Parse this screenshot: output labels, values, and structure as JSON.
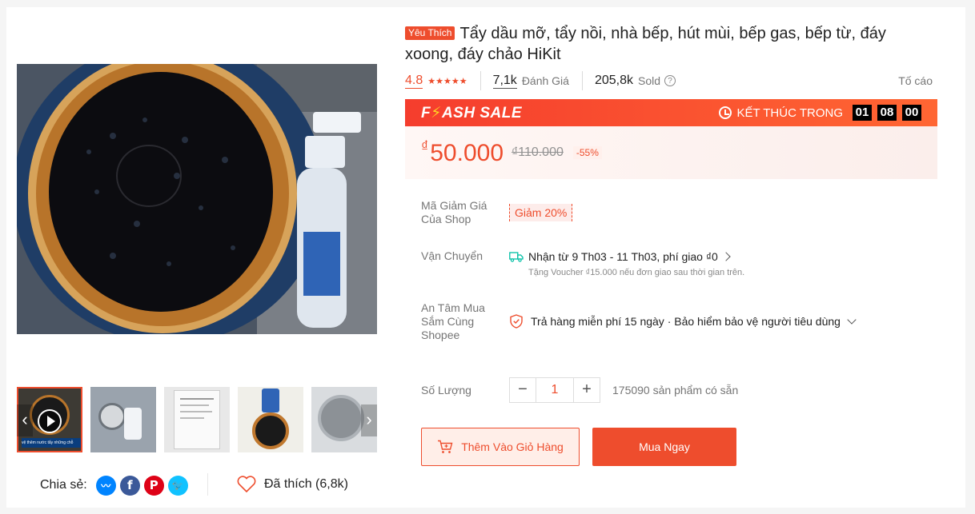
{
  "product": {
    "badge": "Yêu Thích",
    "title": "Tẩy dầu mỡ, tẩy nồi, nhà bếp, hút mùi, bếp gas, bếp từ, đáy xoong, đáy chảo HiKit",
    "rating": "4.8",
    "stars": "★★★★★",
    "reviews_count": "7,1k",
    "reviews_label": "Đánh Giá",
    "sold_count": "205,8k",
    "sold_label": "Sold",
    "report_label": "Tố cáo"
  },
  "flash_sale": {
    "logo_pre": "F",
    "logo_bolt": "⚡",
    "logo_post": "ASH SALE",
    "ends_label": "KẾT THÚC TRONG",
    "hours": "01",
    "minutes": "08",
    "seconds": "00"
  },
  "price": {
    "currency_symbol": "₫",
    "current": "50.000",
    "original": "₫110.000",
    "discount": "-55%"
  },
  "voucher": {
    "label_line1": "Mã Giảm Giá",
    "label_line2": "Của Shop",
    "tag": "Giảm 20%"
  },
  "shipping": {
    "label": "Vận Chuyển",
    "text": "Nhận từ 9 Th03 - 11 Th03, phí giao ₫0",
    "sub": "Tặng Voucher ₫15.000 nếu đơn giao sau thời gian trên."
  },
  "guarantee": {
    "label_line1": "An Tâm Mua",
    "label_line2": "Sắm Cùng",
    "label_line3": "Shopee",
    "text": "Trả hàng miễn phí 15 ngày · Bảo hiểm bảo vệ người tiêu dùng"
  },
  "quantity": {
    "label": "Số Lượng",
    "minus": "−",
    "value": "1",
    "plus": "+",
    "stock": "175090 sản phẩm có sẵn"
  },
  "actions": {
    "add_to_cart": "Thêm Vào Giỏ Hàng",
    "buy_now": "Mua Ngay"
  },
  "gallery": {
    "prev": "‹",
    "next": "›",
    "thumb_caption": "vệ thêm nước tẩy những chỗ chưa đi sạch"
  },
  "social": {
    "share_label": "Chia sẻ:",
    "like_label": "Đã thích (6,8k)"
  },
  "colors": {
    "brand": "#ee4d2d",
    "flash": "#f53d2d"
  }
}
